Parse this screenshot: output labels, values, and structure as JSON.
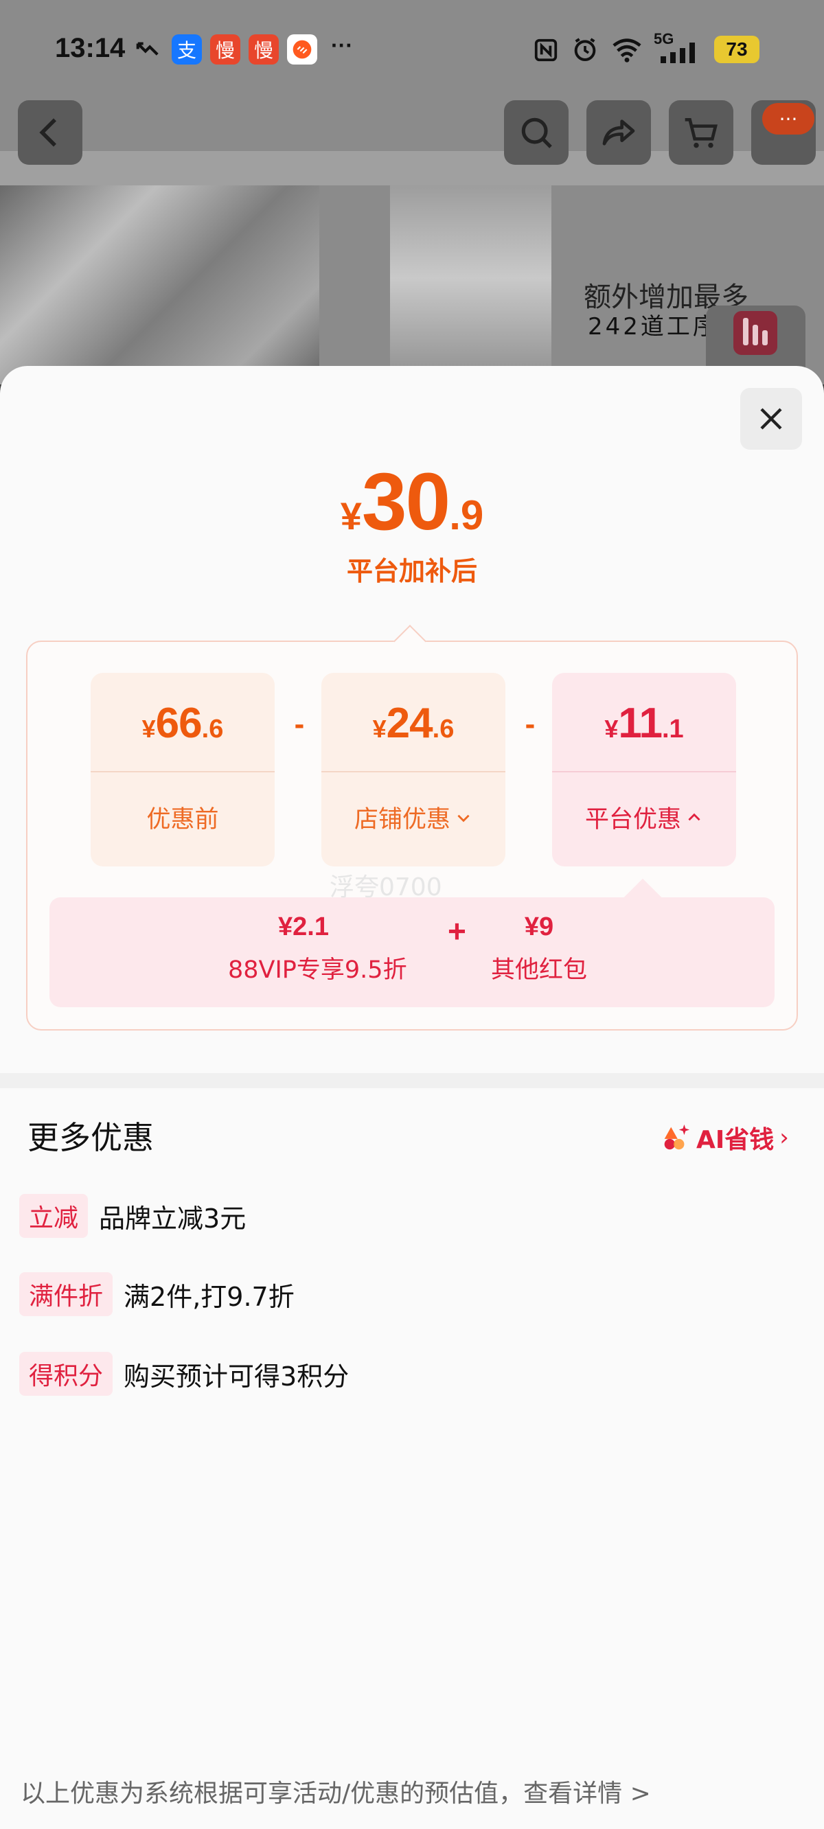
{
  "status_bar": {
    "time": "13:14",
    "app_icons": [
      {
        "name": "alipay-icon",
        "glyph": "支",
        "color": "#1677ff"
      },
      {
        "name": "slow-app-icon",
        "glyph": "慢",
        "color": "#e8462c"
      },
      {
        "name": "slow-app-icon-2",
        "glyph": "慢",
        "color": "#e8462c"
      }
    ],
    "more": "···",
    "network": "5G",
    "battery": "73"
  },
  "background": {
    "headline": "额外增加最多",
    "subline": "242道工序"
  },
  "nav": {
    "more_badge": "···"
  },
  "sheet": {
    "final_price": {
      "currency": "¥",
      "integer": "30",
      "decimal": ".9"
    },
    "final_caption": "平台加补后",
    "cards": [
      {
        "currency": "¥",
        "integer": "66",
        "decimal": ".6",
        "label": "优惠前",
        "style": "orange",
        "chevron": "none"
      },
      {
        "currency": "¥",
        "integer": "24",
        "decimal": ".6",
        "label": "店铺优惠",
        "style": "orange",
        "chevron": "down"
      },
      {
        "currency": "¥",
        "integer": "11",
        "decimal": ".1",
        "label": "平台优惠",
        "style": "pink",
        "chevron": "up"
      }
    ],
    "operators": [
      "-",
      "-"
    ],
    "platform_detail": [
      {
        "amount": "¥2.1",
        "desc": "88VIP专享9.5折"
      },
      {
        "amount": "¥9",
        "desc": "其他红包"
      }
    ],
    "detail_plus": "+",
    "watermark": "浮夸0700",
    "more_section": {
      "title": "更多优惠",
      "ai_link": "AI省钱",
      "ai_arrow": "›",
      "items": [
        {
          "tag": "立减",
          "text": "品牌立减3元"
        },
        {
          "tag": "满件折",
          "text": "满2件,打9.7折"
        },
        {
          "tag": "得积分",
          "text": "购买预计可得3积分"
        }
      ]
    },
    "footer": "以上优惠为系统根据可享活动/优惠的预估值，查看详情 >"
  },
  "colors": {
    "accent_orange": "#ee5a0e",
    "accent_red": "#e0213f"
  }
}
